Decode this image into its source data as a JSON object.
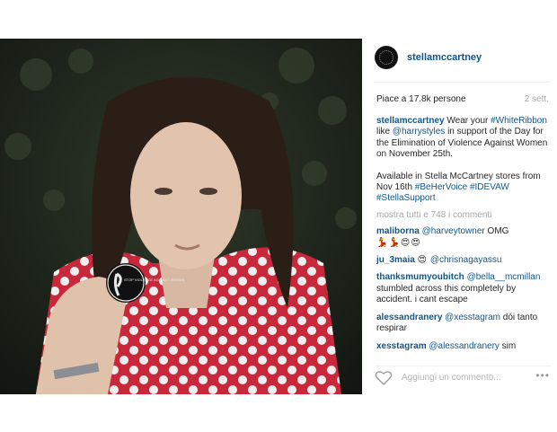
{
  "profile": {
    "username": "stellamccartney"
  },
  "post": {
    "likes_text": "Piace a 17.8k persone",
    "time": "2 sett.",
    "caption": {
      "user": "stellamccartney",
      "p1_a": " Wear your ",
      "tag1": "#WhiteRibbon",
      "p1_b": " like ",
      "tag2": "@harrystyles",
      "p1_c": " in support of the Day for the Elimination of Violence Against Women on November 25th.",
      "p2_a": "Available in Stella McCartney stores from Nov 16th ",
      "tag3": "#BeHerVoice",
      "tag4": "#IDEVAW",
      "tag5": "#StellaSupport"
    },
    "show_all": "mostra tutti e 748 i commenti",
    "badge_text": "STOP VIOLENCE AGAINST WOMEN"
  },
  "comments": [
    {
      "user": "maliborna",
      "mention": "@harveytowner",
      "text": " OMG",
      "emoji": "💃💃😍😍"
    },
    {
      "user": "ju_3maia",
      "emoji": "😍",
      "mention": "@chrisnagayassu"
    },
    {
      "user": "thanksmumyoubitch",
      "mention": "@bella__mcmillan",
      "text": "stumbled across this completely by accident. i cant escape"
    },
    {
      "user": "alessandranery",
      "mention": "@xesstagram",
      "text": " dói tanto respirar"
    },
    {
      "user": "xesstagram",
      "mention": "@alessandranery",
      "text": " sim"
    }
  ],
  "footer": {
    "placeholder": "Aggiungi un commento...",
    "more": "•••"
  },
  "icons": {
    "heart": "heart-icon",
    "more": "more-options-icon",
    "avatar": "avatar"
  },
  "colors": {
    "link": "#125688",
    "muted": "#a5a7aa",
    "shirt": "#c9283a"
  }
}
